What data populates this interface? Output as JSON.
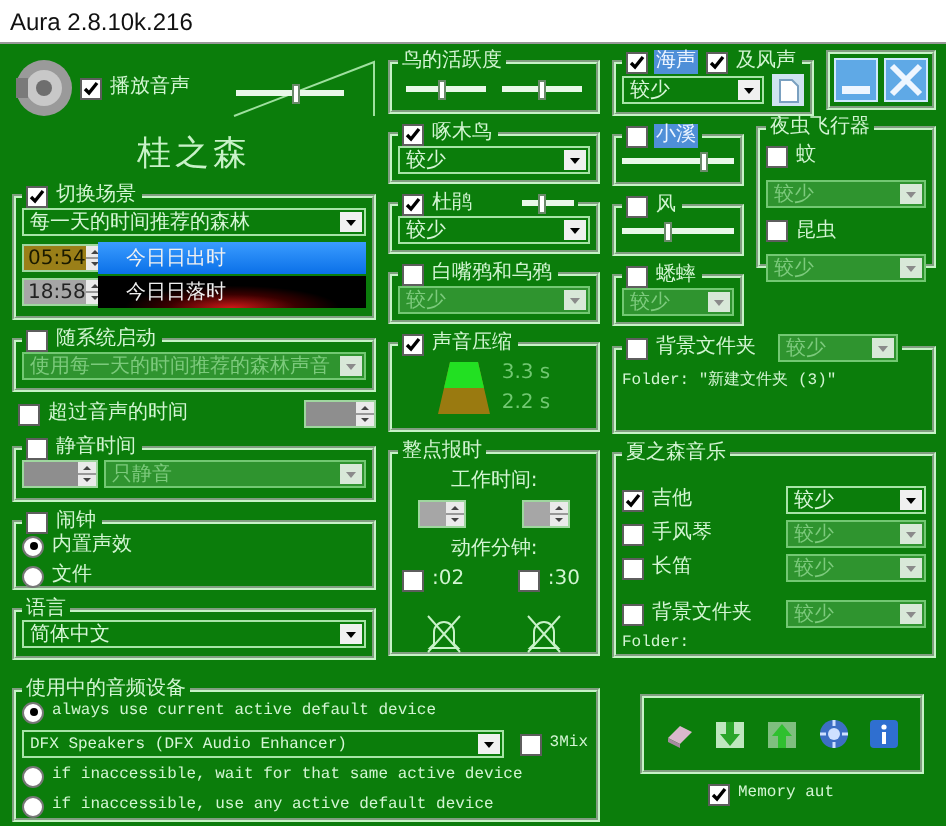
{
  "window": {
    "title": "Aura 2.8.10k.216",
    "buttons": [
      {
        "kind": "minimize"
      },
      {
        "kind": "close"
      }
    ]
  },
  "sound": {
    "label": "播放音声",
    "checked": true,
    "volume": {
      "level": 0.55
    }
  },
  "forest": "桂之森",
  "scene": {
    "label": "切换场景",
    "checked": true,
    "mode": "每一天的时间推荐的森林",
    "times": [
      {
        "time": "05:54",
        "label": "今日日出时",
        "kind": "sunrise"
      },
      {
        "time": "18:58",
        "label": "今日日落时",
        "kind": "sunset"
      }
    ]
  },
  "autostart": {
    "label": "随系统启动",
    "checked": false,
    "mode": "使用每一天的时间推荐的森林声音"
  },
  "limit": {
    "label": "超过音声的时间",
    "checked": false
  },
  "mute": {
    "label": "静音时间",
    "checked": false,
    "mode": "只静音"
  },
  "alarm": {
    "label": "闹钟",
    "checked": false,
    "options": [
      {
        "label": "内置声效",
        "selected": true
      },
      {
        "label": "文件",
        "selected": false
      }
    ]
  },
  "language": {
    "label": "语言",
    "value": "简体中文"
  },
  "bird_activity": {
    "label": "鸟的活跃度",
    "sliders": [
      {
        "level": 0.45
      },
      {
        "level": 0.5
      }
    ]
  },
  "woodpecker": {
    "label": "啄木鸟",
    "checked": true,
    "amount": "较少"
  },
  "cuckoo": {
    "label": "杜鹃",
    "checked": true,
    "level": 0.35,
    "amount": "较少"
  },
  "crows": {
    "label": "白嘴鸦和乌鸦",
    "checked": false,
    "amount": "较少"
  },
  "compression": {
    "label": "声音压缩",
    "checked": true,
    "readings": [
      "3.3 s",
      "2.2 s"
    ]
  },
  "chime": {
    "label": "整点报时",
    "hours_label": "工作时间:",
    "minutes_label": "动作分钟:",
    "minutes": [
      {
        "label": ":02",
        "checked": false
      },
      {
        "label": ":30",
        "checked": false
      }
    ]
  },
  "sea": {
    "label": "海声",
    "checked": true,
    "highlighted": true,
    "amount": "较少",
    "wind": {
      "label": "及风声",
      "checked": true
    }
  },
  "stream": {
    "label": "小溪",
    "checked": false,
    "highlighted": true,
    "level": 0.75
  },
  "wind": {
    "label": "风",
    "checked": false,
    "highlighted": false,
    "level": 0.4
  },
  "crickets": {
    "label": "蟋蟀",
    "checked": false,
    "highlighted": false,
    "amount": "较少"
  },
  "insects": {
    "label": "夜虫飞行器",
    "items": [
      {
        "label": "蚊",
        "checked": false,
        "amount": "较少"
      },
      {
        "label": "昆虫",
        "checked": false,
        "amount": "较少"
      }
    ]
  },
  "background": {
    "label": "背景文件夹",
    "checked": false,
    "amount": "较少",
    "folder": "Folder: \"新建文件夹 (3)\""
  },
  "music": {
    "label": "夏之森音乐",
    "items": [
      {
        "label": "吉他",
        "checked": true,
        "amount": "较少"
      },
      {
        "label": "手风琴",
        "checked": false,
        "amount": "较少"
      },
      {
        "label": "长笛",
        "checked": false,
        "amount": "较少"
      },
      {
        "label": "背景文件夹",
        "checked": false,
        "amount": "较少"
      }
    ],
    "folder": "Folder:"
  },
  "device": {
    "label": "使用中的音频设备",
    "value": "DFX Speakers (DFX Audio Enhancer)",
    "mix": {
      "label": "3Mix",
      "checked": false
    },
    "options": [
      {
        "label": "always use current active default device",
        "selected": true
      },
      {
        "label": "if inaccessible, wait for that same active device",
        "selected": false
      },
      {
        "label": "if inaccessible, use any active default device",
        "selected": false
      }
    ]
  },
  "toolbar": [
    {
      "kind": "eraser"
    },
    {
      "kind": "download"
    },
    {
      "kind": "upload"
    },
    {
      "kind": "settings"
    },
    {
      "kind": "info"
    }
  ],
  "memory": {
    "label": "Memory aut",
    "checked": true
  }
}
